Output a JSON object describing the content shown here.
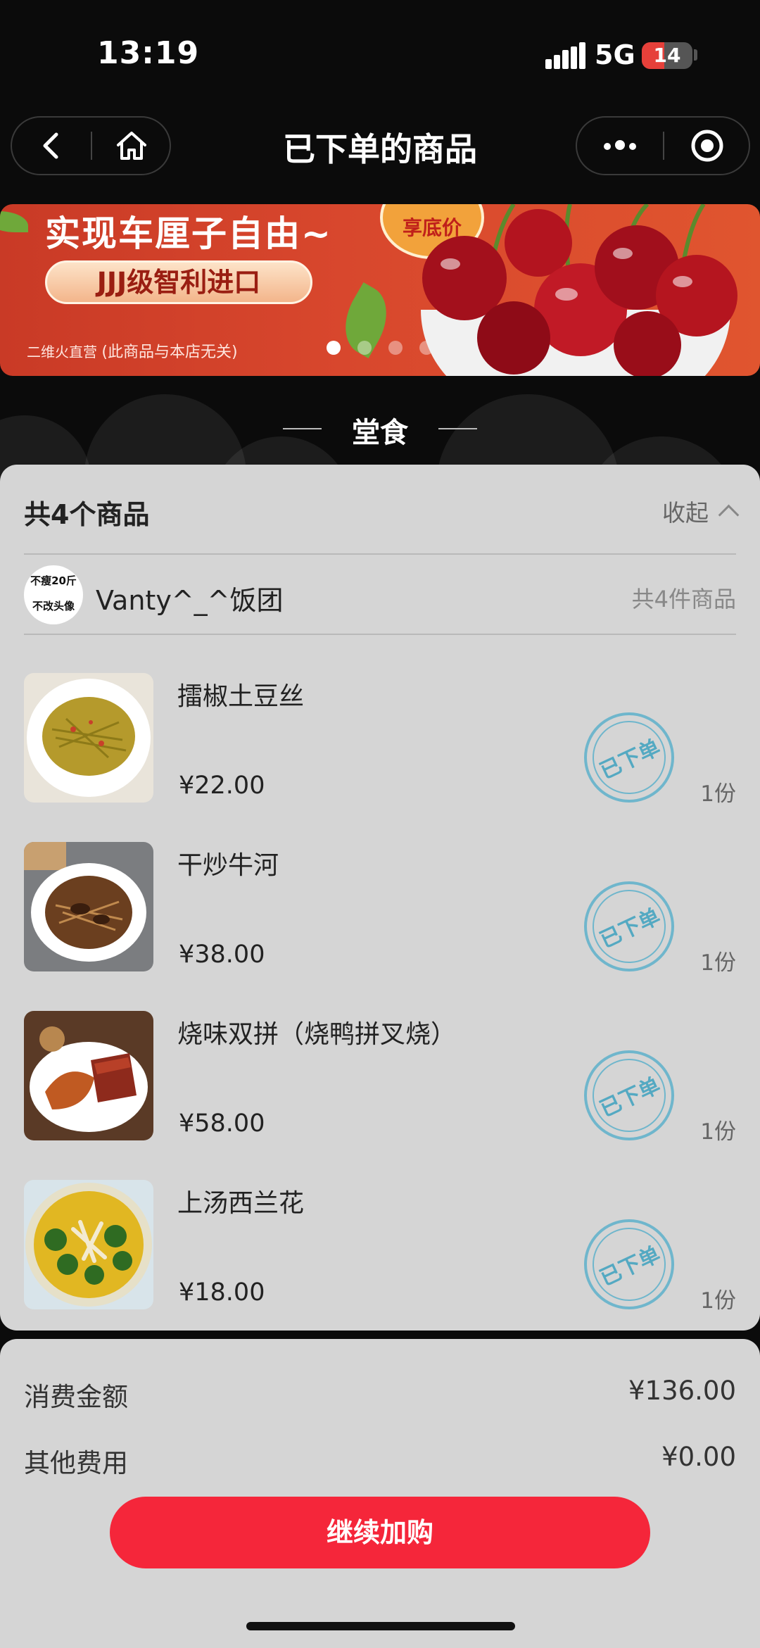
{
  "status_bar": {
    "time": "13:19",
    "network": "5G",
    "battery": "14"
  },
  "nav": {
    "title": "已下单的商品"
  },
  "banner": {
    "headline": "实现车厘子自由~",
    "pill": "JJJ级智利进口",
    "source": "二维火直营",
    "disclaimer": "(此商品与本店无关)",
    "badge": "享底价"
  },
  "section": {
    "label": "堂食"
  },
  "order": {
    "title": "共4个商品",
    "collapse_label": "收起",
    "store": {
      "avatar_text_1": "不瘦20斤",
      "avatar_text_2": "不改头像",
      "name": "Vanty^_^饭团",
      "count_label": "共4件商品"
    },
    "items": [
      {
        "name": "擂椒土豆丝",
        "price": "¥22.00",
        "qty": "1份",
        "stamp": "已下单",
        "image": "shredded-potato"
      },
      {
        "name": "干炒牛河",
        "price": "¥38.00",
        "qty": "1份",
        "stamp": "已下单",
        "image": "beef-chow-fun"
      },
      {
        "name": "烧味双拼（烧鸭拼叉烧）",
        "price": "¥58.00",
        "qty": "1份",
        "stamp": "已下单",
        "image": "roast-duck-char-siu"
      },
      {
        "name": "上汤西兰花",
        "price": "¥18.00",
        "qty": "1份",
        "stamp": "已下单",
        "image": "broccoli-soup"
      }
    ]
  },
  "totals": {
    "amount_label": "消费金额",
    "amount_value": "¥136.00",
    "other_label": "其他费用",
    "other_value": "¥0.00",
    "cta_label": "继续加购"
  },
  "colors": {
    "accent": "#f5263a",
    "stamp": "#54a9c2",
    "card": "#d5d5d5"
  }
}
